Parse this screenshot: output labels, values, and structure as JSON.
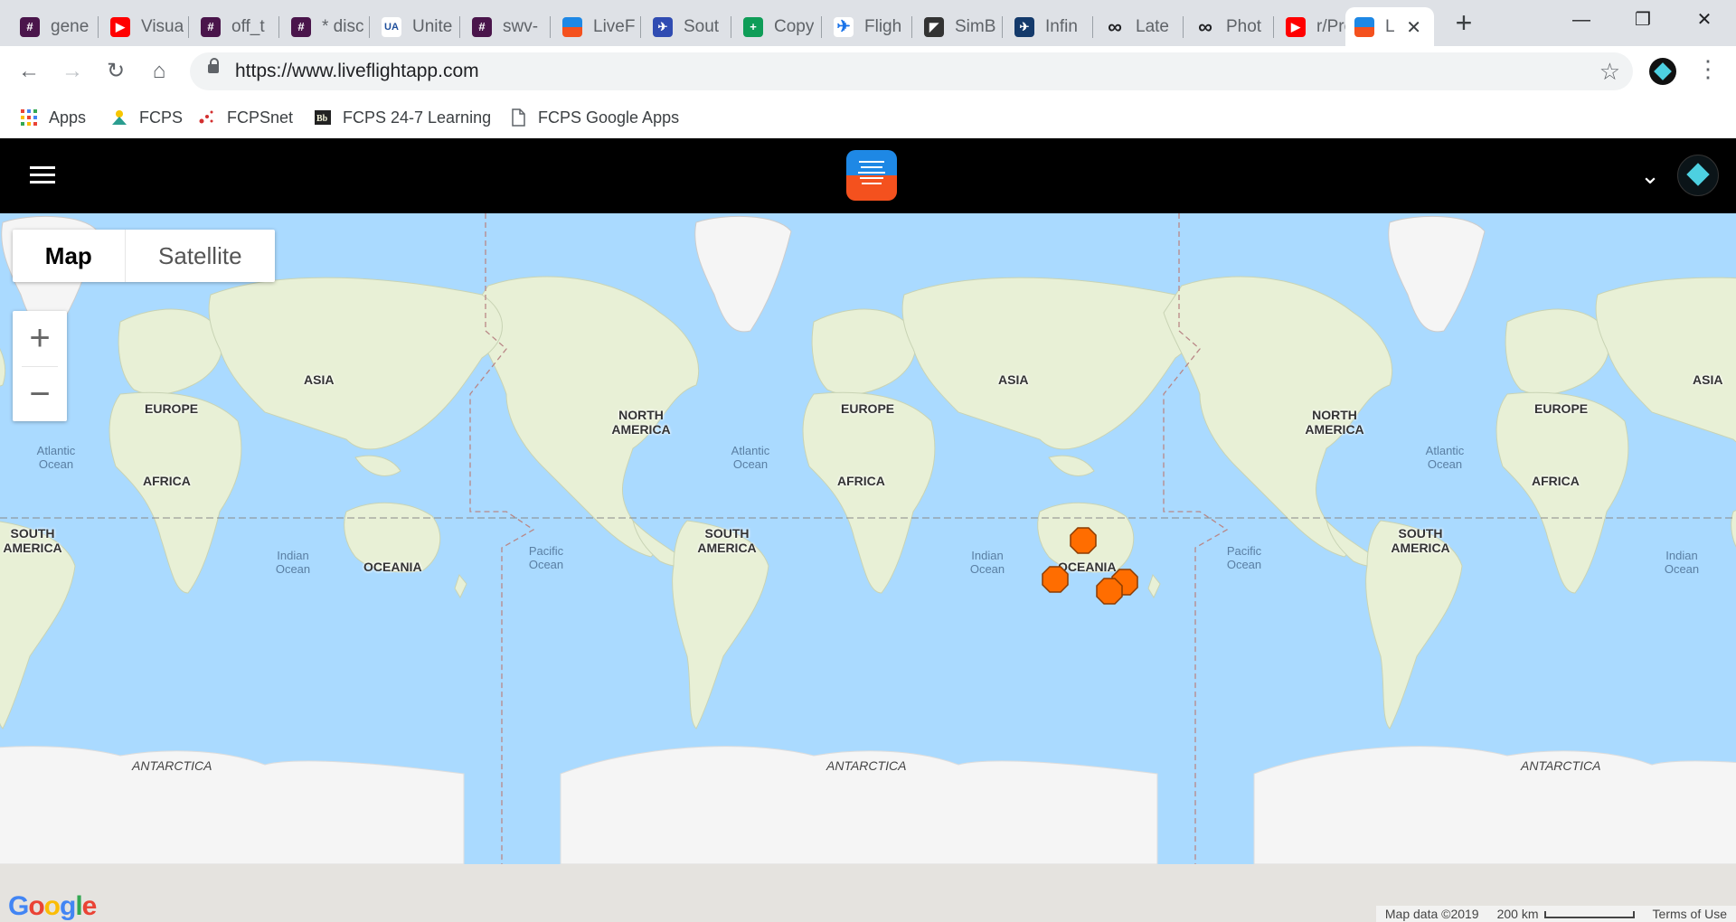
{
  "browser": {
    "tabs": [
      {
        "title": "gene",
        "icon": "slack-icon",
        "color": "#4a154b"
      },
      {
        "title": "Visua",
        "icon": "youtube-icon",
        "color": "#ff0000"
      },
      {
        "title": "off_t",
        "icon": "slack-icon",
        "color": "#4a154b"
      },
      {
        "title": "* disc",
        "icon": "slack-icon",
        "color": "#4a154b"
      },
      {
        "title": "Unite",
        "icon": "united-icon",
        "color": "#1f4f9c"
      },
      {
        "title": "swv-",
        "icon": "slack-icon",
        "color": "#4a154b"
      },
      {
        "title": "LiveF",
        "icon": "liveflight-icon",
        "color": "#1e88e5"
      },
      {
        "title": "Sout",
        "icon": "southwest-icon",
        "color": "#304cb2"
      },
      {
        "title": "Copy",
        "icon": "sheets-icon",
        "color": "#0f9d58"
      },
      {
        "title": "Fligh",
        "icon": "plane-icon",
        "color": "#1a73e8"
      },
      {
        "title": "SimB",
        "icon": "simbrief-icon",
        "color": "#333333"
      },
      {
        "title": "Infin",
        "icon": "infinite-flight-icon",
        "color": "#143a6b"
      },
      {
        "title": "Late",
        "icon": "infinity-icon",
        "color": "#202124"
      },
      {
        "title": "Phot",
        "icon": "infinity-icon",
        "color": "#202124"
      },
      {
        "title": "r/Pro",
        "icon": "youtube-icon",
        "color": "#ff0000"
      },
      {
        "title": "L",
        "icon": "liveflight-icon",
        "color": "#1e88e5"
      }
    ],
    "url": "https://www.liveflightapp.com",
    "bookmarks": [
      {
        "label": "Apps",
        "icon": "apps-grid-icon"
      },
      {
        "label": "FCPS",
        "icon": "fcps-icon"
      },
      {
        "label": "FCPSnet",
        "icon": "fcpsnet-icon"
      },
      {
        "label": "FCPS 24-7 Learning",
        "icon": "blackboard-icon"
      },
      {
        "label": "FCPS Google Apps",
        "icon": "page-icon"
      }
    ]
  },
  "map": {
    "map_type": {
      "map": "Map",
      "satellite": "Satellite"
    },
    "zoom": {
      "in": "+",
      "out": "−"
    },
    "continents": {
      "asia": "ASIA",
      "europe": "EUROPE",
      "africa": "AFRICA",
      "south_america": "SOUTH AMERICA",
      "north_america": "NORTH AMERICA",
      "oceania": "OCEANIA",
      "antarctica": "ANTARCTICA"
    },
    "oceans": {
      "atlantic": "Atlantic Ocean",
      "indian": "Indian Ocean",
      "pacific": "Pacific Ocean"
    },
    "footer": {
      "logo": "Google",
      "map_data": "Map data ©2019",
      "scale": "200 km",
      "terms": "Terms of Use"
    },
    "colors": {
      "water": "#aadaff",
      "land": "#e8f0d6",
      "ice": "#f5f5f5",
      "marker": "#ff6d00"
    }
  }
}
